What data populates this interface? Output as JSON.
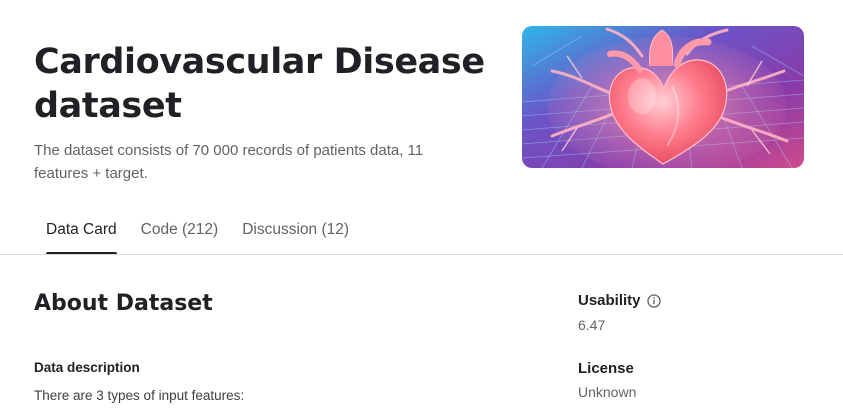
{
  "dataset": {
    "title": "Cardiovascular Disease dataset",
    "subtitle": "The dataset consists of 70 000 records of patients data, 11 features + target.",
    "cover_image": "heart-illustration"
  },
  "tabs": [
    {
      "label": "Data Card",
      "active": true
    },
    {
      "label": "Code (212)",
      "active": false
    },
    {
      "label": "Discussion (12)",
      "active": false
    }
  ],
  "about": {
    "heading": "About Dataset",
    "description_heading": "Data description",
    "description_text": "There are 3 types of input features:"
  },
  "sidebar": {
    "usability": {
      "label": "Usability",
      "value": "6.47",
      "icon": "info-icon"
    },
    "license": {
      "label": "License",
      "value": "Unknown"
    }
  },
  "colors": {
    "text_primary": "#202124",
    "text_secondary": "#5f6368",
    "divider": "#dadce0",
    "cover_background": "#4a4aa8",
    "heart": "#f0556a"
  }
}
